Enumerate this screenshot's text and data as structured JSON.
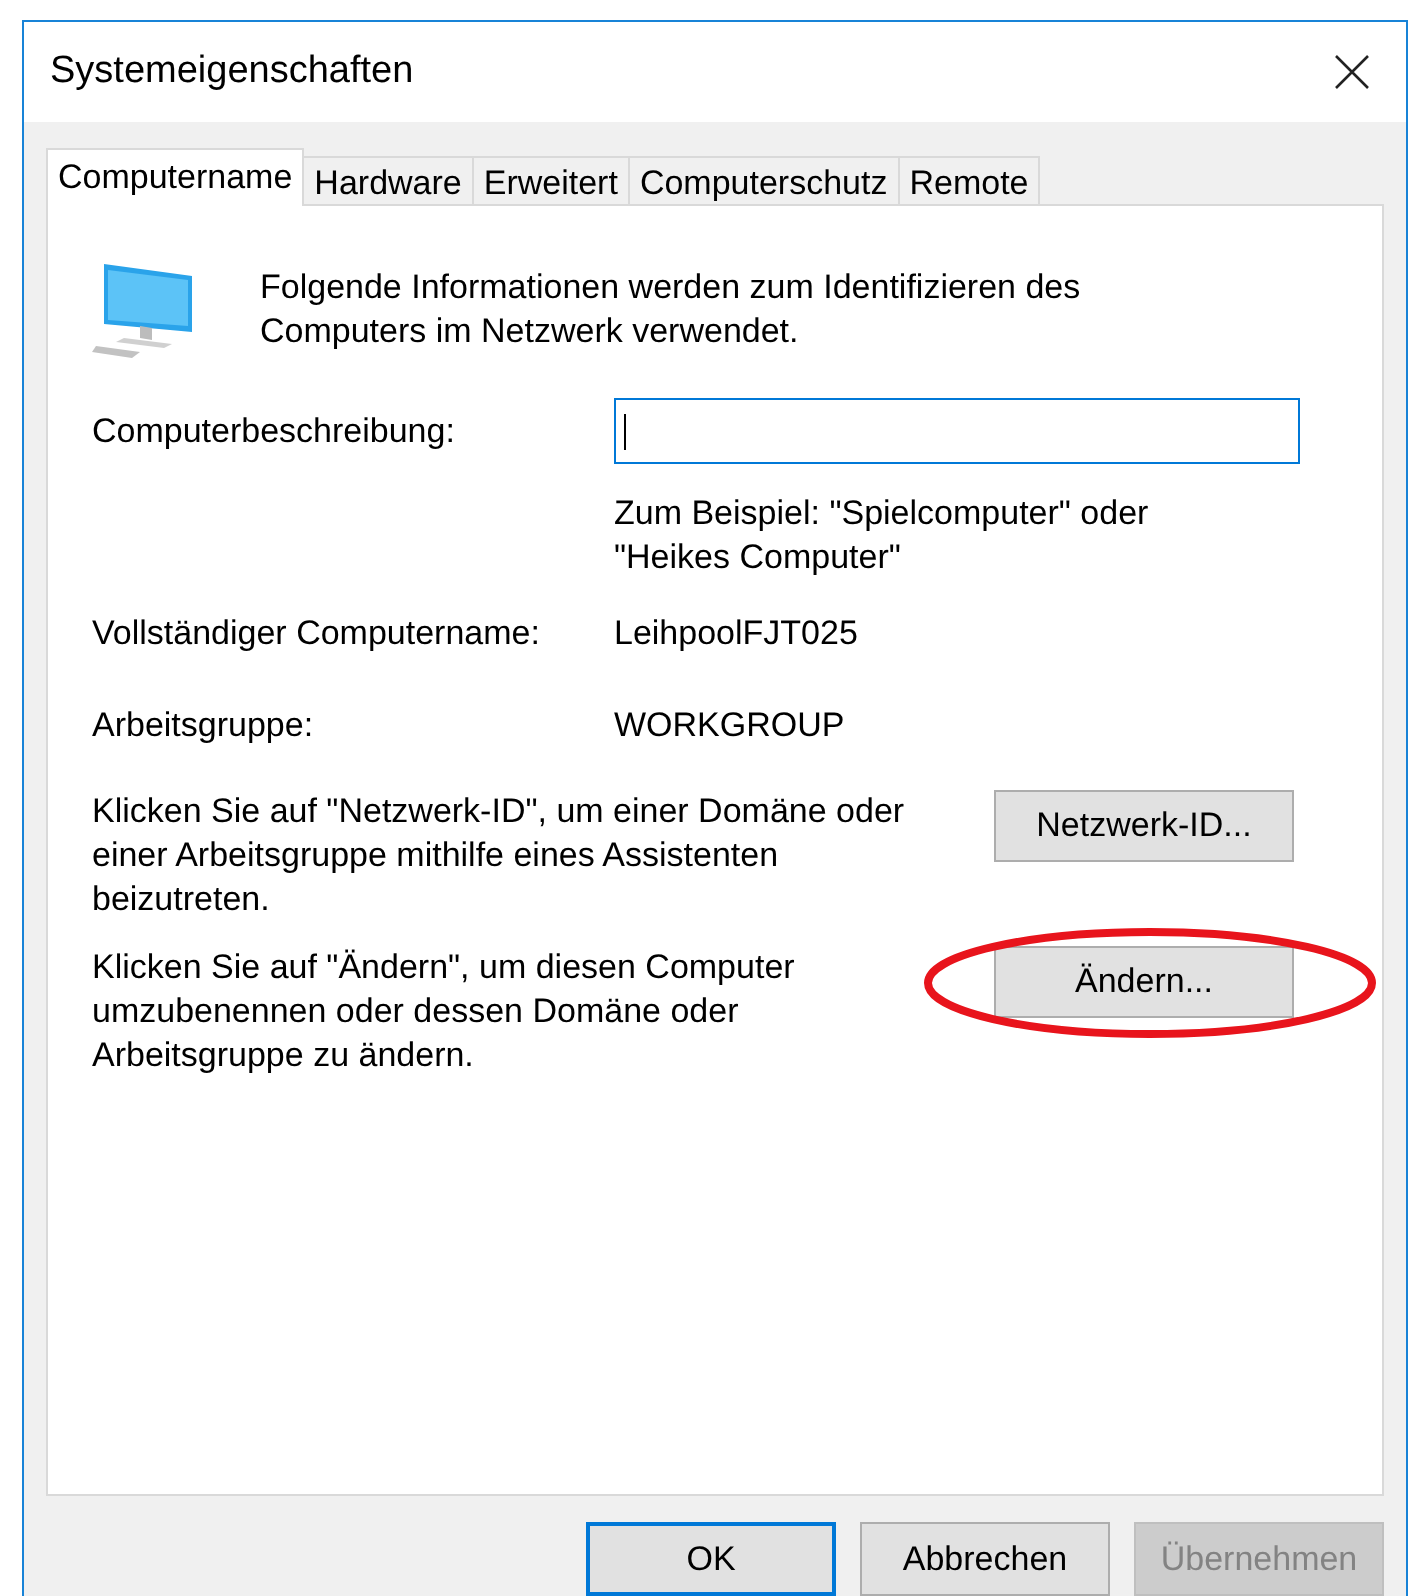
{
  "window": {
    "title": "Systemeigenschaften"
  },
  "tabs": [
    {
      "label": "Computername",
      "selected": true
    },
    {
      "label": "Hardware",
      "selected": false
    },
    {
      "label": "Erweitert",
      "selected": false
    },
    {
      "label": "Computerschutz",
      "selected": false
    },
    {
      "label": "Remote",
      "selected": false
    }
  ],
  "intro": "Folgende Informationen werden zum Identifizieren des Computers im Netzwerk verwendet.",
  "description_field": {
    "label": "Computerbeschreibung:",
    "focused": true
  },
  "hint": "Zum Beispiel: \"Spielcomputer\" oder \"Heikes Computer\"",
  "info_rows": [
    {
      "label": "Vollständiger Computername:",
      "value": "LeihpoolFJT025"
    },
    {
      "label": "Arbeitsgruppe:",
      "value": "WORKGROUP"
    }
  ],
  "actions": [
    {
      "text": "Klicken Sie auf \"Netzwerk-ID\", um einer Domäne oder einer Arbeitsgruppe mithilfe eines Assistenten beizutreten.",
      "button": "Netzwerk-ID...",
      "circled": false
    },
    {
      "text": "Klicken Sie auf \"Ändern\", um diesen Computer umzubenennen oder dessen Domäne oder Arbeitsgruppe zu ändern.",
      "button": "Ändern...",
      "circled": true
    }
  ],
  "buttons": [
    {
      "label": "OK",
      "default": true,
      "disabled": false
    },
    {
      "label": "Abbrechen",
      "default": false,
      "disabled": false
    },
    {
      "label": "Übernehmen",
      "default": false,
      "disabled": true
    }
  ]
}
